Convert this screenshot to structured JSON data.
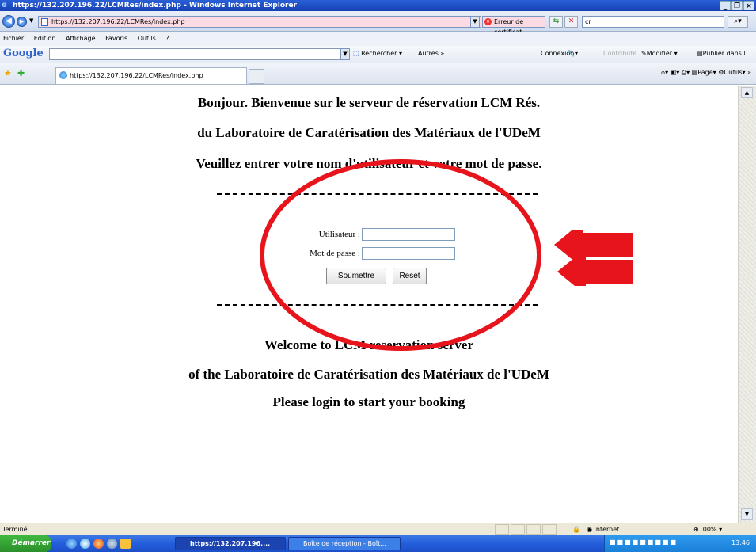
{
  "window": {
    "title": "https://132.207.196.22/LCMRes/index.php - Windows Internet Explorer",
    "controls": [
      "_",
      "×"
    ]
  },
  "address": {
    "url": "https://132.207.196.22/LCMRes/index.php",
    "cert_error": "Erreur de certificat",
    "search_value": "cr"
  },
  "menu": [
    "Fichier",
    "Edition",
    "Affichage",
    "Favoris",
    "Outils",
    "?"
  ],
  "google_bar": {
    "logo": "Google",
    "search_button": "Rechercher",
    "more": "Autres »",
    "login": "Connexion",
    "contribute": "Contribute",
    "modify": "Modifier",
    "publish": "Publier dans l"
  },
  "tab": {
    "title": "https://132.207.196.22/LCMRes/index.php"
  },
  "tab_tools": {
    "page": "Page",
    "tools": "Outils"
  },
  "page": {
    "heading_fr_1": "Bonjour. Bienvenue sur le serveur de réservation LCM Rés.",
    "heading_fr_2": "du Laboratoire de Caratérisation des Matériaux de l'UDeM",
    "heading_fr_3": "Veuillez entrer votre nom d'utilisateur et votre mot de passe.",
    "username_label": "Utilisateur :",
    "password_label": "Mot de passe :",
    "submit_label": "Soumettre",
    "reset_label": "Reset",
    "heading_en_1": "Welcome to LCM reservation server",
    "heading_en_2": "of the Laboratoire de Caratérisation des Matériaux de l'UDeM",
    "heading_en_3": "Please login to start your booking"
  },
  "status": {
    "text": "Terminé",
    "zone": "Internet",
    "zoom": "100%"
  },
  "taskbar": {
    "start": "Démarrer",
    "task1": "https://132.207.196....",
    "task2": "Boîte de réception - Boît...",
    "clock": "13:46"
  },
  "colors": {
    "annotation_red": "#e8141c",
    "titlebar_blue": "#1641b3"
  }
}
